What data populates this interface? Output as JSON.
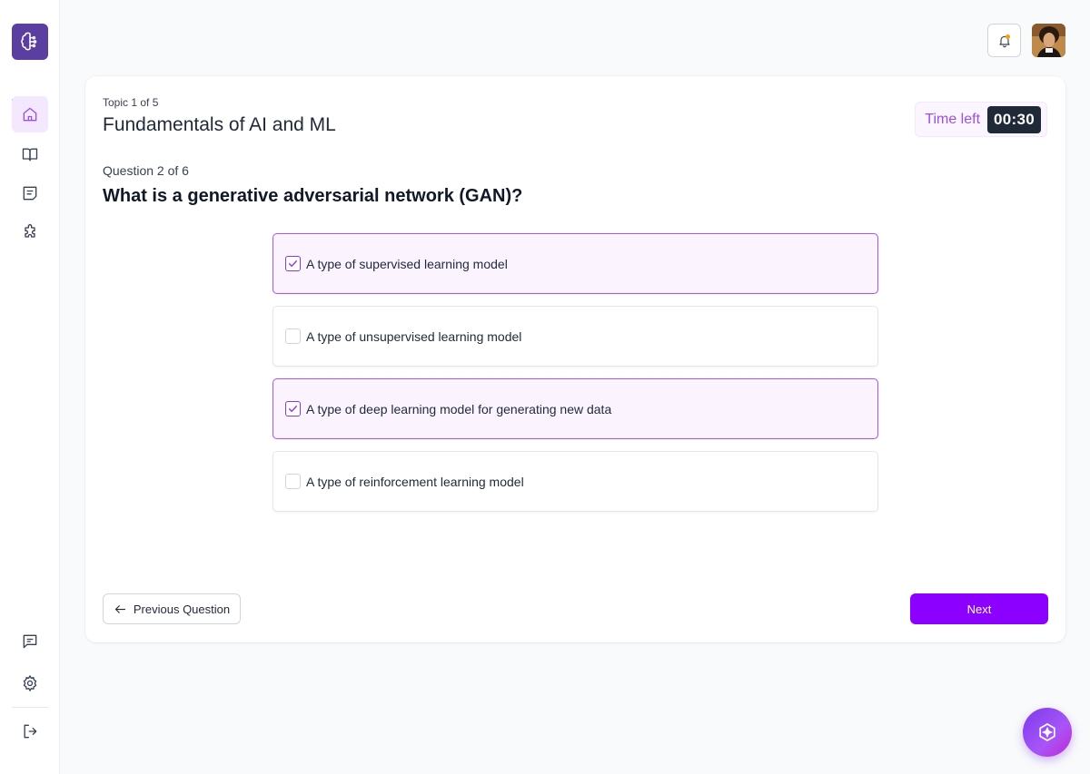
{
  "sidebar": {
    "logo_icon": "brain-icon",
    "items": [
      {
        "icon": "home-icon",
        "active": true
      },
      {
        "icon": "book-icon",
        "active": false
      },
      {
        "icon": "notes-icon",
        "active": false
      },
      {
        "icon": "puzzle-icon",
        "active": false
      }
    ],
    "bottom_items": [
      {
        "icon": "chat-icon"
      },
      {
        "icon": "settings-icon"
      },
      {
        "icon": "logout-icon"
      }
    ]
  },
  "header": {
    "notification_icon": "bell-icon",
    "avatar": "user-avatar"
  },
  "quiz": {
    "topic_progress": "Topic 1 of 5",
    "topic_title": "Fundamentals of AI and ML",
    "timer_label": "Time left",
    "timer_value": "00:30",
    "question_progress": "Question 2 of 6",
    "question": "What is a generative adversarial network (GAN)?",
    "options": [
      {
        "text": "A type of supervised learning model",
        "selected": true
      },
      {
        "text": "A type of unsupervised learning model",
        "selected": false
      },
      {
        "text": "A type of deep learning model for generating new data",
        "selected": true
      },
      {
        "text": "A type of reinforcement learning model",
        "selected": false
      }
    ],
    "prev_label": "Previous Question",
    "next_label": "Next"
  },
  "colors": {
    "accent": "#8b00ff",
    "selected_bg": "#fbf4ff",
    "selected_border": "#a855f7",
    "timer_bg": "#1f2937"
  }
}
